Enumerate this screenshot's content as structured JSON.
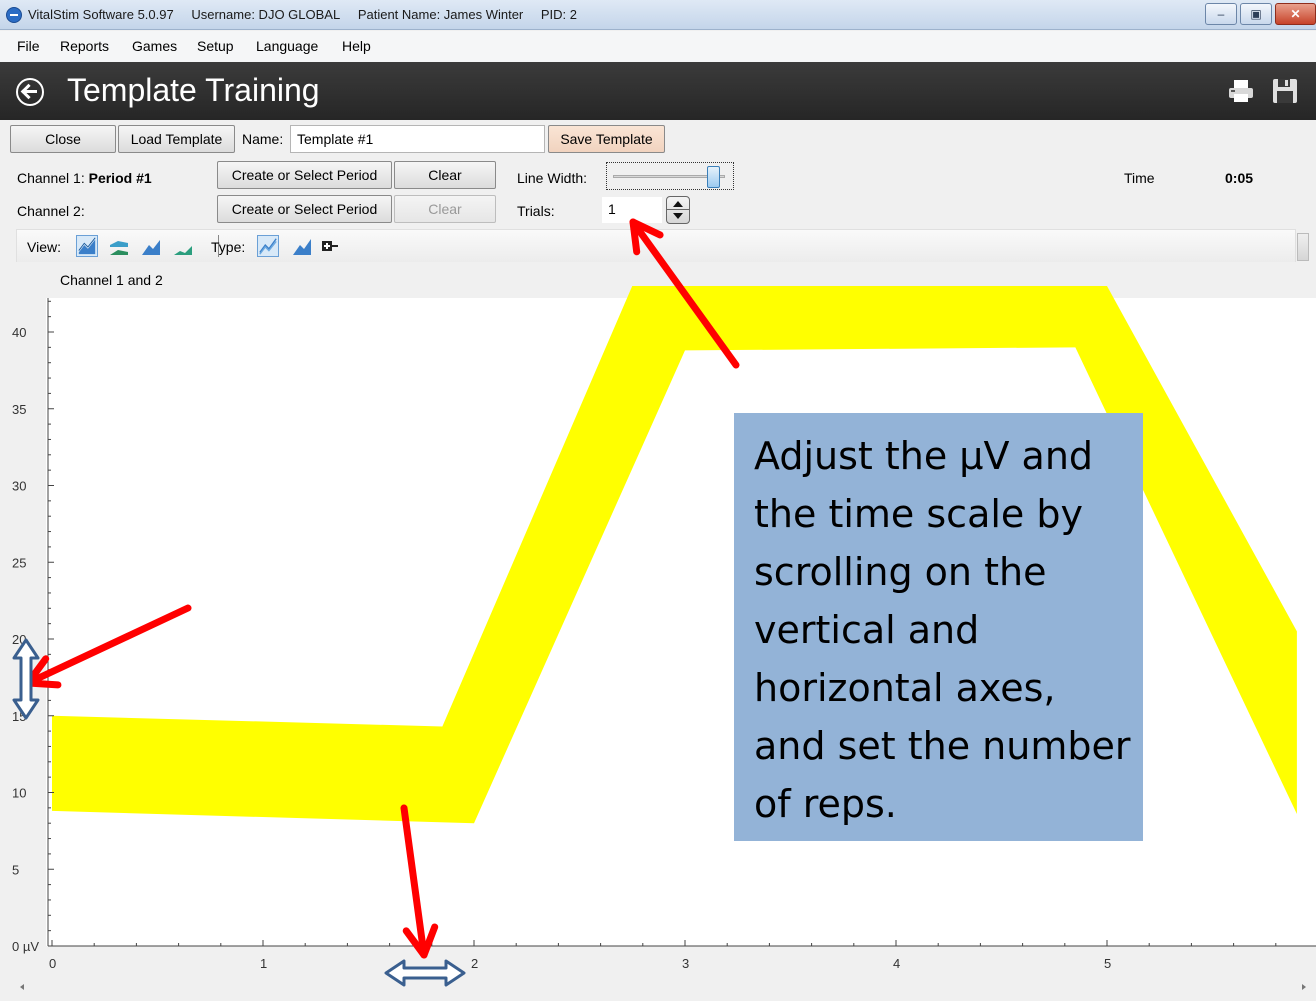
{
  "window": {
    "app_name": "VitalStim Software 5.0.97",
    "username": "Username: DJO GLOBAL",
    "patient_name": "Patient Name: James Winter",
    "pid": "PID: 2",
    "minimize": "–",
    "maximize": "▣",
    "close": "✕"
  },
  "menu": [
    "File",
    "Reports",
    "Games",
    "Setup",
    "Language",
    "Help"
  ],
  "header": {
    "title": "Template Training"
  },
  "toolbar": {
    "close_label": "Close",
    "load_template_label": "Load Template",
    "name_label": "Name:",
    "name_value": "Template #1",
    "save_template_label": "Save Template"
  },
  "channels": {
    "channel1_label": "Channel 1:",
    "channel1_period": "Period #1",
    "channel2_label": "Channel 2:",
    "create_period_label": "Create or Select Period",
    "clear_label": "Clear",
    "line_width_label": "Line Width:",
    "line_width_level": 0.87,
    "trials_label": "Trials:",
    "trials_value": "1",
    "time_label": "Time",
    "time_value": "0:05"
  },
  "view_bar": {
    "view_label": "View:",
    "type_label": "Type:"
  },
  "chart_data": {
    "type": "area",
    "title": "Channel 1 and 2",
    "ylabel": "µV",
    "xlim": [
      0,
      5.9
    ],
    "ylim": [
      0,
      42
    ],
    "x_ticks": [
      "0",
      "1",
      "2",
      "3",
      "4",
      "5"
    ],
    "y_ticks": [
      "0 µV",
      "5",
      "10",
      "15",
      "20",
      "25",
      "30",
      "35",
      "40"
    ],
    "template_band": {
      "color": "#ffff00",
      "upper": [
        [
          0,
          15.0
        ],
        [
          1.85,
          14.3
        ],
        [
          2.75,
          43
        ],
        [
          5.0,
          43
        ],
        [
          5.9,
          20.5
        ]
      ],
      "lower": [
        [
          0,
          8.8
        ],
        [
          2.0,
          8.0
        ],
        [
          3.0,
          38.8
        ],
        [
          4.85,
          39.0
        ],
        [
          5.9,
          8.6
        ]
      ]
    }
  },
  "annotation": {
    "text": "Adjust the µV and the time scale by scrolling on the vertical and horizontal axes, and set the number of reps.",
    "color": "#93b3d7",
    "arrow_color": "#ff0000",
    "axis_arrow_color": "#3a5f8f"
  }
}
